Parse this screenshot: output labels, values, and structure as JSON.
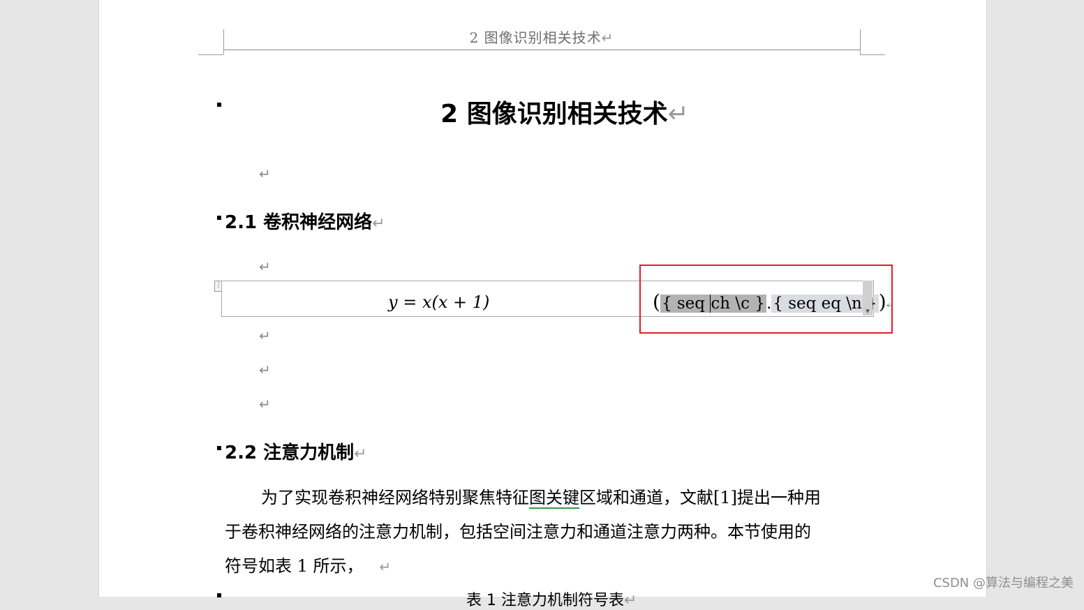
{
  "header": {
    "text": "2  图像识别相关技术",
    "mark": "↵"
  },
  "chapter": {
    "title": "2 图像识别相关技术",
    "mark": "↵"
  },
  "section1": {
    "title": "2.1 卷积神经网络",
    "mark": "↵"
  },
  "paragraph_mark": "↵",
  "equation": {
    "handle": "⋮",
    "formula_y": "y",
    "formula_eq": " = ",
    "formula_x": "x",
    "formula_rest": "(x + 1)",
    "open_paren": "(",
    "field1_prefix": "{ seq ",
    "field1_rest": "ch \\c }",
    "dot": ".",
    "field2": "{ seq eq \\n }",
    "close_paren": ")",
    "cell_mark": "↵"
  },
  "section2": {
    "title": "2.2 注意力机制",
    "mark": "↵"
  },
  "body": {
    "line1_a": "为了实现卷积神经网络特别聚焦特征",
    "line1_link": "图关键",
    "line1_b": "区域和通道，文献[1]提出一种用",
    "line2": "于卷积神经网络的注意力机制，包括空间注意力和通道注意力两种。本节使用的",
    "line3": "符号如表  1 所示，",
    "line3_mark": "↵"
  },
  "caption": {
    "text": "表  1  注意力机制符号表",
    "mark": "↵"
  },
  "watermark": "CSDN @算法与编程之美",
  "colors": {
    "highlight_box": "#e02020",
    "field_shade_dark": "#b3b3b3",
    "field_shade_light": "#d9dce0"
  }
}
